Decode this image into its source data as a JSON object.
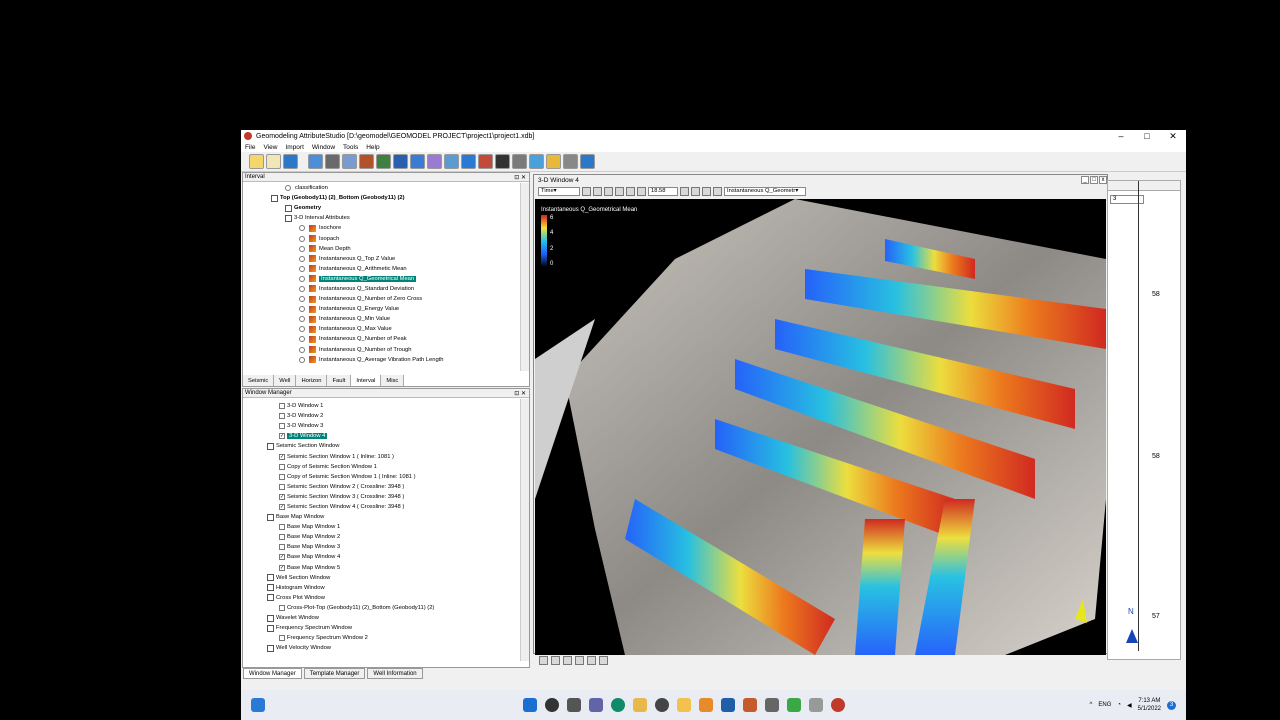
{
  "window": {
    "title": "Geomodeling AttributeStudio [D:\\geomodel\\GEOMODEL PROJECT\\project1\\project1.xdb]"
  },
  "menu": [
    "File",
    "View",
    "Import",
    "Window",
    "Tools",
    "Help"
  ],
  "interval_panel": {
    "title": "Interval",
    "items": [
      {
        "label": "classification",
        "kind": "radio",
        "indent": 2
      },
      {
        "label": "Top (Geobody11) (2)_Bottom (Geobody11) (2)",
        "kind": "node",
        "indent": 1,
        "bold": true
      },
      {
        "label": "Geometry",
        "kind": "node",
        "indent": 2,
        "bold": true
      },
      {
        "label": "3-D Interval Attributes",
        "kind": "folder",
        "indent": 2
      },
      {
        "label": "Isochore",
        "kind": "attr",
        "indent": 3
      },
      {
        "label": "Isopach",
        "kind": "attr",
        "indent": 3
      },
      {
        "label": "Mean Depth",
        "kind": "attr",
        "indent": 3
      },
      {
        "label": "Instantaneous Q_Top Z Value",
        "kind": "attr",
        "indent": 3
      },
      {
        "label": "Instantaneous Q_Arithmetic Mean",
        "kind": "attr",
        "indent": 3
      },
      {
        "label": "Instantaneous Q_Geometrical Mean",
        "kind": "attr",
        "indent": 3,
        "selected": true
      },
      {
        "label": "Instantaneous Q_Standard Deviation",
        "kind": "attr",
        "indent": 3
      },
      {
        "label": "Instantaneous Q_Number of Zero Cross",
        "kind": "attr",
        "indent": 3
      },
      {
        "label": "Instantaneous Q_Energy Value",
        "kind": "attr",
        "indent": 3
      },
      {
        "label": "Instantaneous Q_Min Value",
        "kind": "attr",
        "indent": 3
      },
      {
        "label": "Instantaneous Q_Max Value",
        "kind": "attr",
        "indent": 3
      },
      {
        "label": "Instantaneous Q_Number of Peak",
        "kind": "attr",
        "indent": 3
      },
      {
        "label": "Instantaneous Q_Number of Trough",
        "kind": "attr",
        "indent": 3
      },
      {
        "label": "Instantaneous Q_Average Vibration Path Length",
        "kind": "attr",
        "indent": 3
      }
    ],
    "tabs": [
      "Seismic",
      "Well",
      "Horizon",
      "Fault",
      "Interval",
      "Misc"
    ],
    "active_tab": "Interval"
  },
  "window_manager": {
    "title": "Window Manager",
    "items": [
      {
        "label": "3-D Window 1",
        "kind": "check",
        "checked": false,
        "indent": 2
      },
      {
        "label": "3-D Window 2",
        "kind": "check",
        "checked": false,
        "indent": 2
      },
      {
        "label": "3-D Window 3",
        "kind": "check",
        "checked": false,
        "indent": 2
      },
      {
        "label": "3-D Window 4",
        "kind": "check",
        "checked": true,
        "indent": 2,
        "selected": true
      },
      {
        "label": "Seismic Section Window",
        "kind": "group",
        "indent": 1
      },
      {
        "label": "Seismic Section Window 1 ( Inline: 1081 )",
        "kind": "check",
        "checked": true,
        "indent": 2
      },
      {
        "label": "Copy of Seismic Section Window 1",
        "kind": "check",
        "checked": false,
        "indent": 2
      },
      {
        "label": "Copy of Seismic Section Window 1 ( Inline: 1081 )",
        "kind": "check",
        "checked": false,
        "indent": 2
      },
      {
        "label": "Seismic Section Window 2 ( Crossline: 3948 )",
        "kind": "check",
        "checked": false,
        "indent": 2
      },
      {
        "label": "Seismic Section Window 3 ( Crossline: 3948 )",
        "kind": "check",
        "checked": true,
        "indent": 2
      },
      {
        "label": "Seismic Section Window 4 ( Crossline: 3948 )",
        "kind": "check",
        "checked": true,
        "indent": 2
      },
      {
        "label": "Base Map Window",
        "kind": "group",
        "indent": 1
      },
      {
        "label": "Base Map Window 1",
        "kind": "check",
        "checked": false,
        "indent": 2
      },
      {
        "label": "Base Map Window 2",
        "kind": "check",
        "checked": false,
        "indent": 2
      },
      {
        "label": "Base Map Window 3",
        "kind": "check",
        "checked": false,
        "indent": 2
      },
      {
        "label": "Base Map Window 4",
        "kind": "check",
        "checked": true,
        "indent": 2
      },
      {
        "label": "Base Map Window 5",
        "kind": "check",
        "checked": true,
        "indent": 2
      },
      {
        "label": "Well Section Window",
        "kind": "group",
        "indent": 1
      },
      {
        "label": "Histogram Window",
        "kind": "group",
        "indent": 1
      },
      {
        "label": "Cross Plot Window",
        "kind": "group",
        "indent": 1
      },
      {
        "label": "Cross-Plot-Top (Geobody11) (2)_Bottom (Geobody11) (2)",
        "kind": "check",
        "checked": false,
        "indent": 2
      },
      {
        "label": "Wavelet Window",
        "kind": "group",
        "indent": 1
      },
      {
        "label": "Frequency Spectrum Window",
        "kind": "group",
        "indent": 1
      },
      {
        "label": "Frequency Spectrum Window 2",
        "kind": "check",
        "checked": false,
        "indent": 2
      },
      {
        "label": "Well Velocity Window",
        "kind": "group",
        "indent": 1
      }
    ]
  },
  "bottom_tabs": [
    "Window Manager",
    "Template Manager",
    "Well Information"
  ],
  "win3d": {
    "title": "3-D Window 4",
    "domain": "Time",
    "zoom": "18.58",
    "attribute": "Instantaneous Q_Geometr",
    "legend_title": "Instantaneous Q_Geometrical Mean",
    "legend_ticks": [
      "6",
      "4",
      "2",
      "0"
    ]
  },
  "right_window": {
    "field": "3",
    "ticks": [
      "58",
      "58",
      "57"
    ],
    "north": "N"
  },
  "taskbar": {
    "lang": "ENG",
    "time": "7:13 AM",
    "date": "5/1/2022",
    "badge": "3"
  }
}
